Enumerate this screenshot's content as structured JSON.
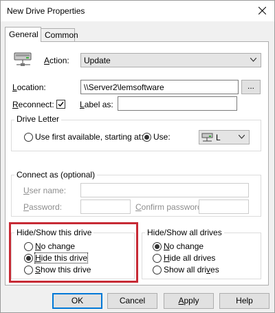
{
  "window": {
    "title": "New Drive Properties"
  },
  "tabs": [
    {
      "label": "General",
      "active": true
    },
    {
      "label": "Common",
      "active": false
    }
  ],
  "general": {
    "action_label": "Action:",
    "action_value": "Update",
    "location_label": "Location:",
    "location_value": "\\\\Server2\\lemsoftware",
    "browse_label": "...",
    "reconnect_label": "Reconnect:",
    "reconnect_checked": true,
    "label_as_label": "Label as:",
    "label_as_value": ""
  },
  "drive_letter": {
    "title": "Drive Letter",
    "option_first": "Use first available, starting at:",
    "option_use": "Use:",
    "selected": "use",
    "drive_value": "L"
  },
  "connect_as": {
    "title": "Connect as (optional)",
    "username_label": "User name:",
    "password_label": "Password:",
    "confirm_label": "Confirm password:"
  },
  "hide_show_drive": {
    "title": "Hide/Show this drive",
    "options": [
      "No change",
      "Hide this drive",
      "Show this drive"
    ],
    "selected": 1
  },
  "hide_show_all": {
    "title": "Hide/Show all drives",
    "options": [
      "No change",
      "Hide all drives",
      "Show all drives"
    ],
    "selected": 0
  },
  "buttons": {
    "ok": "OK",
    "cancel": "Cancel",
    "apply": "Apply",
    "help": "Help"
  },
  "colors": {
    "highlight_border": "#c72a35",
    "default_button_border": "#0078d7"
  }
}
